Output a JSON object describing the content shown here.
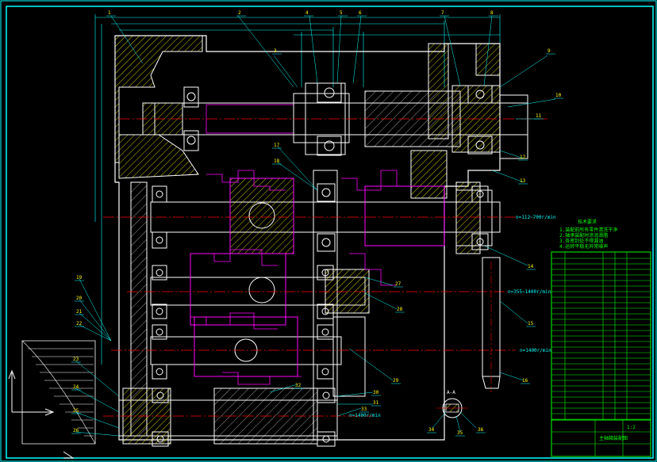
{
  "drawing": {
    "type": "cad-assembly-drawing",
    "colors": {
      "background": "#000000",
      "border": "#00ffff",
      "outline": "#ffffff",
      "hatch": "#ffff00",
      "centerline": "#ff0000",
      "dimension": "#00ffff",
      "gear": "#ff00ff",
      "bearing": "#ffffff",
      "title_block": "#00ff00"
    },
    "shafts": [
      {
        "name": "shaft-1",
        "label": "n=112~700r/min"
      },
      {
        "name": "shaft-2",
        "label": "n=355~1400r/min"
      },
      {
        "name": "shaft-3",
        "label": "n=1400r/min"
      },
      {
        "name": "shaft-4",
        "label": "n=1400r/min"
      }
    ],
    "part_numbers": [
      "1",
      "2",
      "3",
      "4",
      "5",
      "6",
      "7",
      "8",
      "9",
      "10",
      "11",
      "12",
      "13",
      "14",
      "15",
      "16",
      "17",
      "18",
      "19",
      "20",
      "21",
      "22",
      "23",
      "24",
      "25",
      "26",
      "27",
      "28",
      "29",
      "30",
      "31",
      "32",
      "33",
      "34",
      "35",
      "36"
    ],
    "notes_title": "技术要求",
    "notes_lines": [
      "1.装配前所有零件清洗干净",
      "2.轴承装配时涂润滑脂",
      "3.各密封处不得漏油",
      "4.运转平稳无异常噪声"
    ],
    "detail_label": "A-A",
    "title_block": {
      "title": "主轴箱装配图",
      "scale": "1:2"
    },
    "icons": [
      "ucs-axis-icon"
    ]
  }
}
